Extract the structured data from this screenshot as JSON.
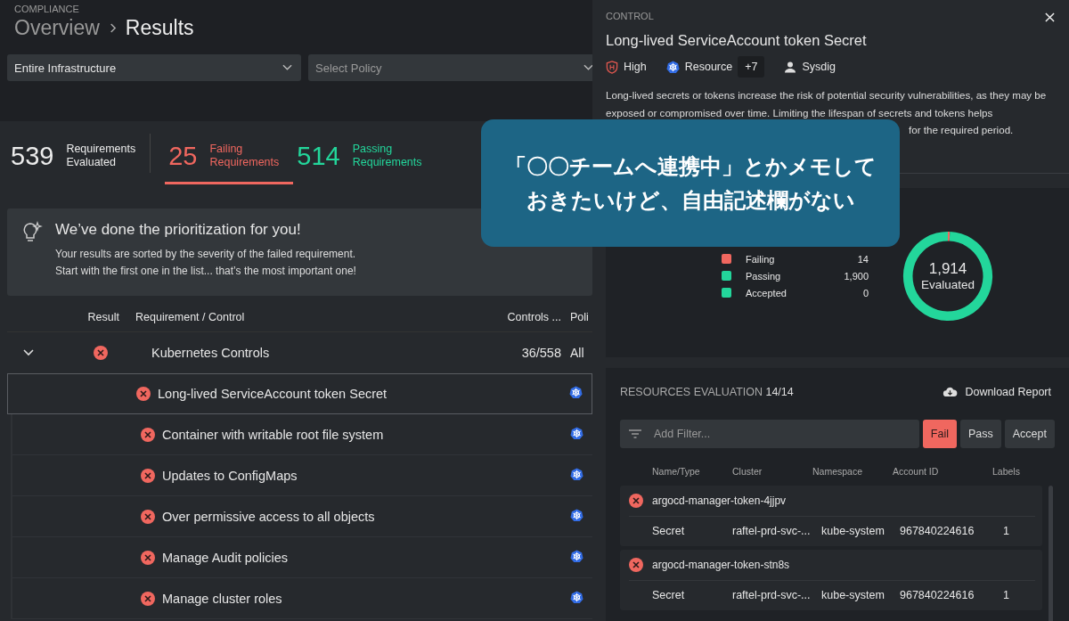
{
  "header": {
    "section": "COMPLIANCE",
    "breadcrumb": [
      {
        "label": "Overview",
        "current": false
      },
      {
        "label": "Results",
        "current": true
      }
    ]
  },
  "filters": [
    {
      "value": "Entire Infrastructure"
    },
    {
      "placeholder": "Select Policy"
    }
  ],
  "stats": [
    {
      "number": "539",
      "label_1": "Requirements",
      "label_2": "Evaluated",
      "kind": "neutral",
      "selected": false
    },
    {
      "number": "25",
      "label_1": "Failing",
      "label_2": "Requirements",
      "kind": "fail",
      "selected": true
    },
    {
      "number": "514",
      "label_1": "Passing",
      "label_2": "Requirements",
      "kind": "pass",
      "selected": false
    }
  ],
  "tip": {
    "title": "We’ve done the prioritization for you!",
    "lines": [
      "Your results are sorted by the severity of the failed requirement.",
      "Start with the first one in the list... that’s the most important one!"
    ]
  },
  "table": {
    "columns": [
      "Result",
      "Requirement / Control",
      "Controls ...",
      "Poli"
    ],
    "group": {
      "name": "Kubernetes Controls",
      "failed": true,
      "controls": "36/558",
      "policy": "All",
      "expanded": true
    },
    "rows": [
      {
        "name": "Long-lived ServiceAccount token Secret",
        "failed": true,
        "selected": true
      },
      {
        "name": "Container with writable root file system",
        "failed": true,
        "selected": false
      },
      {
        "name": "Updates to ConfigMaps",
        "failed": true,
        "selected": false
      },
      {
        "name": "Over permissive access to all objects",
        "failed": true,
        "selected": false
      },
      {
        "name": "Manage Audit policies",
        "failed": true,
        "selected": false
      },
      {
        "name": "Manage cluster roles",
        "failed": true,
        "selected": false
      }
    ]
  },
  "drawer": {
    "label": "CONTROL",
    "title": "Long-lived ServiceAccount token Secret",
    "severity": "High",
    "resource": "Resource",
    "more": "+7",
    "author": "Sysdig",
    "description": "Long-lived secrets or tokens increase the risk of potential security vulnerabilities, as they may be exposed or compromised over time. Limiting the lifespan of secrets and tokens helps",
    "description_tail": "for the required period.",
    "overview": {
      "legend": [
        {
          "value": "14",
          "color": "#f0675f"
        },
        {
          "value": "1,900",
          "color": "#23d69b"
        },
        {
          "value": "0",
          "color": "#23d69b"
        }
      ],
      "center_number": "1,914",
      "center_label": "Evaluated",
      "chart_data": {
        "type": "donut",
        "categories": [
          "Failing",
          "Passing",
          "Accepted"
        ],
        "values": [
          0.73,
          99.27,
          0
        ]
      }
    },
    "evaluation": {
      "title": "RESOURCES EVALUATION",
      "count": "14/14",
      "download": "Download Report",
      "filter_placeholder": "Add Filter...",
      "toggles": [
        {
          "label": "Fail",
          "selected": true
        },
        {
          "label": "Pass",
          "selected": false
        },
        {
          "label": "Accept",
          "selected": false
        }
      ],
      "columns": [
        "Name/Type",
        "Cluster",
        "Namespace",
        "Account ID",
        "Labels"
      ],
      "resources": [
        {
          "name": "argocd-manager-token-4jjpv",
          "failed": true,
          "type": "Secret",
          "cluster": "raftel-prd-svc-...",
          "namespace": "kube-system",
          "account": "967840224616",
          "labels": "1"
        },
        {
          "name": "argocd-manager-token-stn8s",
          "failed": true,
          "type": "Secret",
          "cluster": "raftel-prd-svc-...",
          "namespace": "kube-system",
          "account": "967840224616",
          "labels": "1"
        }
      ]
    }
  },
  "callout": {
    "lines": [
      "「〇〇チームへ連携中」とかメモして",
      "おきたいけど、自由記述欄がない"
    ]
  }
}
